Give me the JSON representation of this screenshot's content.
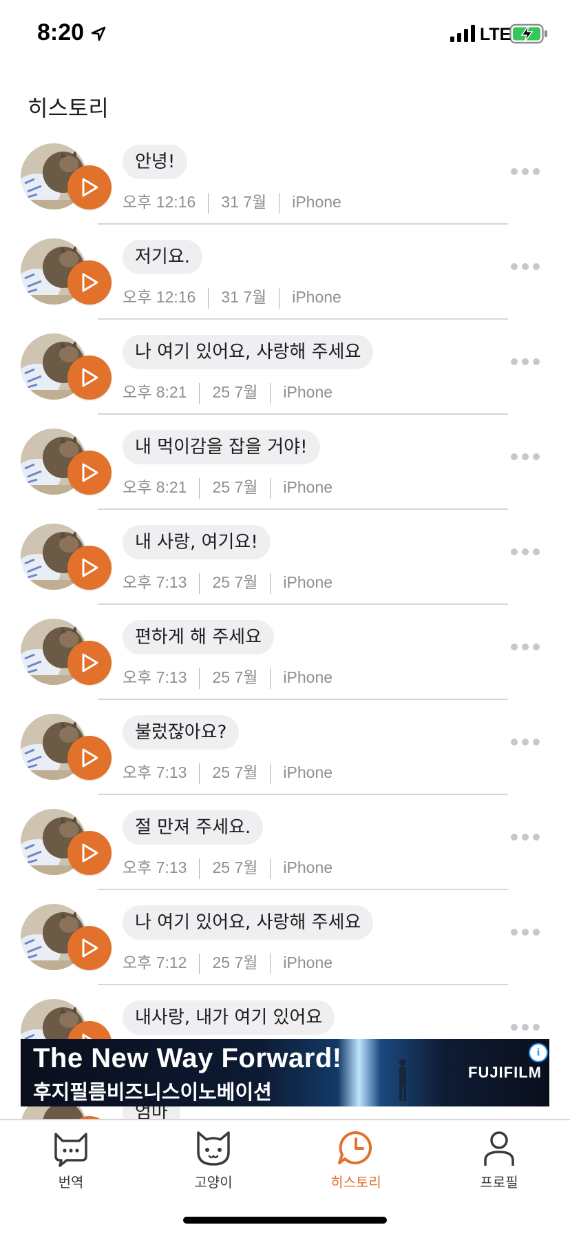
{
  "status_bar": {
    "time": "8:20",
    "network": "LTE"
  },
  "page": {
    "title": "히스토리"
  },
  "history": [
    {
      "text": "안녕!",
      "time": "오후 12:16",
      "date": "31 7월",
      "device": "iPhone"
    },
    {
      "text": "저기요.",
      "time": "오후 12:16",
      "date": "31 7월",
      "device": "iPhone"
    },
    {
      "text": "나 여기 있어요, 사랑해 주세요",
      "time": "오후 8:21",
      "date": "25 7월",
      "device": "iPhone"
    },
    {
      "text": "내 먹이감을 잡을 거야!",
      "time": "오후 8:21",
      "date": "25 7월",
      "device": "iPhone"
    },
    {
      "text": "내 사랑, 여기요!",
      "time": "오후 7:13",
      "date": "25 7월",
      "device": "iPhone"
    },
    {
      "text": "편하게 해 주세요",
      "time": "오후 7:13",
      "date": "25 7월",
      "device": "iPhone"
    },
    {
      "text": "불렀잖아요?",
      "time": "오후 7:13",
      "date": "25 7월",
      "device": "iPhone"
    },
    {
      "text": "절 만져 주세요.",
      "time": "오후 7:13",
      "date": "25 7월",
      "device": "iPhone"
    },
    {
      "text": "나 여기 있어요, 사랑해 주세요",
      "time": "오후 7:12",
      "date": "25 7월",
      "device": "iPhone"
    },
    {
      "text": "내사랑, 내가 여기 있어요",
      "time": "",
      "date": "",
      "device": ""
    },
    {
      "text": "엄마",
      "time": "",
      "date": "",
      "device": ""
    }
  ],
  "ad": {
    "headline": "The New Way Forward!",
    "subline": "후지필름비즈니스이노베이션",
    "brand": "FUJIFILM",
    "info_glyph": "i"
  },
  "tabs": [
    {
      "label": "번역",
      "icon": "chat-cat-icon"
    },
    {
      "label": "고양이",
      "icon": "cat-face-icon"
    },
    {
      "label": "히스토리",
      "icon": "clock-bubble-icon",
      "active": true
    },
    {
      "label": "프로필",
      "icon": "person-icon"
    }
  ],
  "colors": {
    "accent": "#e2712b",
    "bubble": "#efeff1",
    "meta_text": "#8e8e93",
    "battery": "#34c759"
  }
}
